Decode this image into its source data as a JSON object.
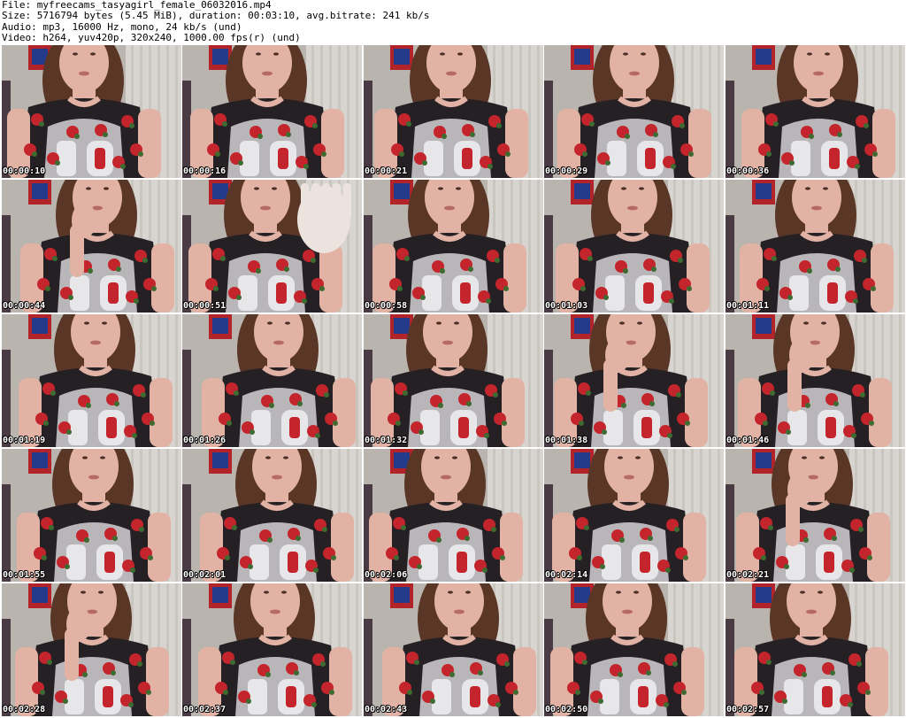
{
  "header": {
    "file_line": "File: myfreecams_tasyagirl_female_06032016.mp4",
    "size_line": "Size: 5716794 bytes (5.45 MiB), duration: 00:03:10, avg.bitrate: 241 kb/s",
    "audio_line": "Audio: mp3, 16000 Hz, mono, 24 kb/s (und)",
    "video_line": "Video: h264, yuv420p, 320x240, 1000.00 fps(r) (und)"
  },
  "colors": {
    "wall": "#b9b4ae",
    "curtain": "#d8d5d0",
    "poster_red": "#b2232a",
    "poster_blue": "#243a8a",
    "hair": "#5a3626",
    "skin": "#e2b3a4",
    "shirt_dark": "#242024",
    "shirt_grey": "#b8b6b8",
    "flower_red": "#c4252c",
    "leaf_green": "#3f6a32"
  },
  "thumbnails": [
    {
      "time": "00:00:10"
    },
    {
      "time": "00:00:16"
    },
    {
      "time": "00:00:21"
    },
    {
      "time": "00:00:29"
    },
    {
      "time": "00:00:36"
    },
    {
      "time": "00:00:44"
    },
    {
      "time": "00:00:51"
    },
    {
      "time": "00:00:58"
    },
    {
      "time": "00:01:03"
    },
    {
      "time": "00:01:11"
    },
    {
      "time": "00:01:19"
    },
    {
      "time": "00:01:26"
    },
    {
      "time": "00:01:32"
    },
    {
      "time": "00:01:38"
    },
    {
      "time": "00:01:46"
    },
    {
      "time": "00:01:55"
    },
    {
      "time": "00:02:01"
    },
    {
      "time": "00:02:06"
    },
    {
      "time": "00:02:14"
    },
    {
      "time": "00:02:21"
    },
    {
      "time": "00:02:28"
    },
    {
      "time": "00:02:37"
    },
    {
      "time": "00:02:43"
    },
    {
      "time": "00:02:50"
    },
    {
      "time": "00:02:57"
    }
  ]
}
